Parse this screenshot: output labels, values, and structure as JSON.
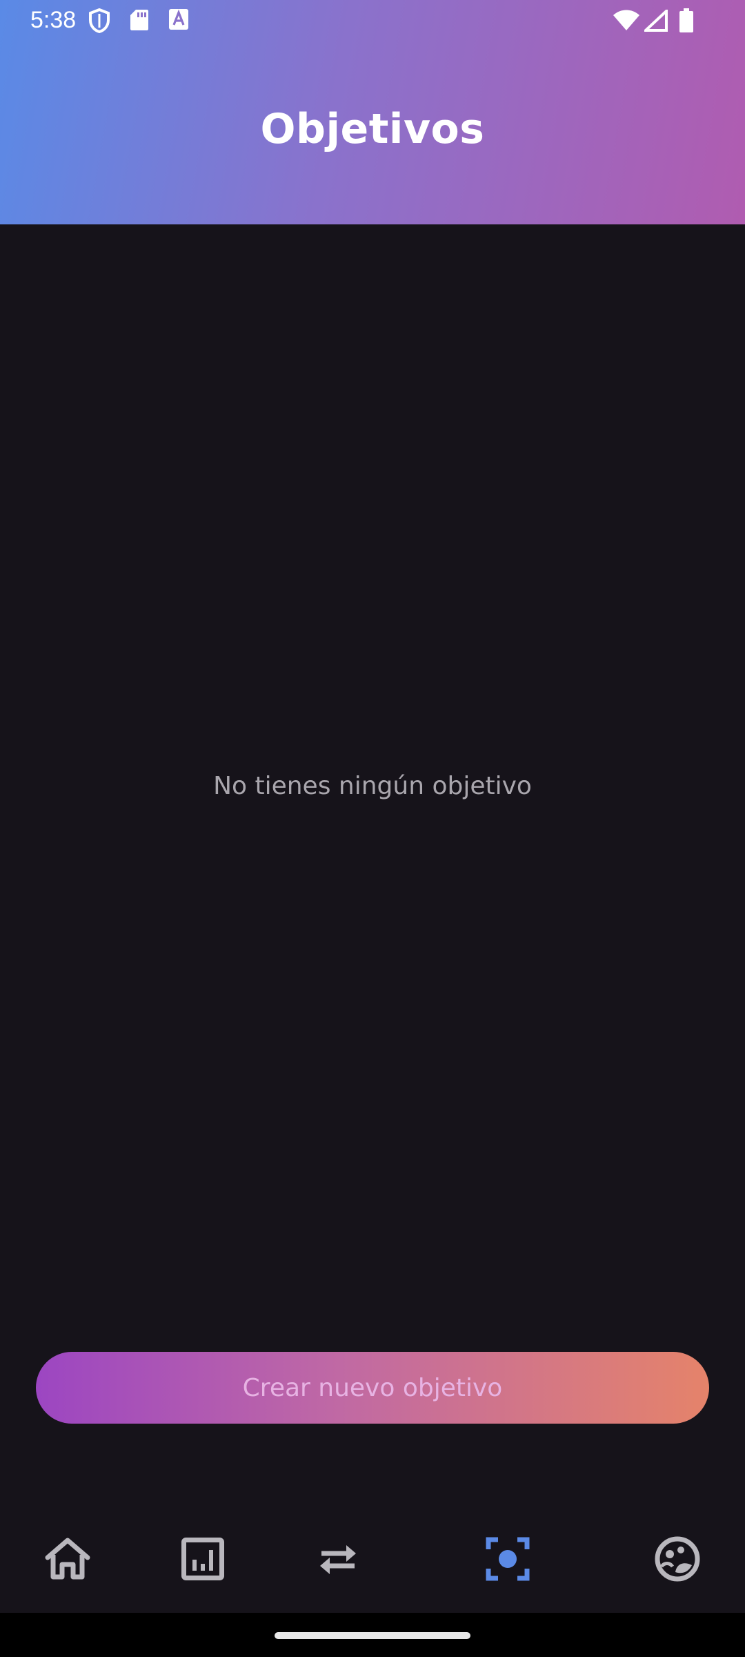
{
  "status_bar": {
    "time": "5:38",
    "icons": [
      "shield-icon",
      "sd-card-icon",
      "font-app-icon",
      "wifi-icon",
      "signal-icon",
      "battery-icon"
    ]
  },
  "header": {
    "title": "Objetivos",
    "gradient_colors": [
      "#5a8ae6",
      "#8a72cc",
      "#b05cb0"
    ]
  },
  "main": {
    "empty_message": "No tienes ningún objetivo"
  },
  "create_button": {
    "label": "Crear nuevo objetivo",
    "gradient_colors": [
      "#9c46c2",
      "#c069a4",
      "#e5836a"
    ]
  },
  "bottom_nav": {
    "items": [
      {
        "icon": "home-icon",
        "active": false
      },
      {
        "icon": "stats-icon",
        "active": false
      },
      {
        "icon": "transfer-icon",
        "active": false
      },
      {
        "icon": "goals-icon",
        "active": true
      },
      {
        "icon": "profile-icon",
        "active": false
      }
    ],
    "active_color": "#5b8ae6",
    "inactive_color": "#b9b7bd"
  }
}
